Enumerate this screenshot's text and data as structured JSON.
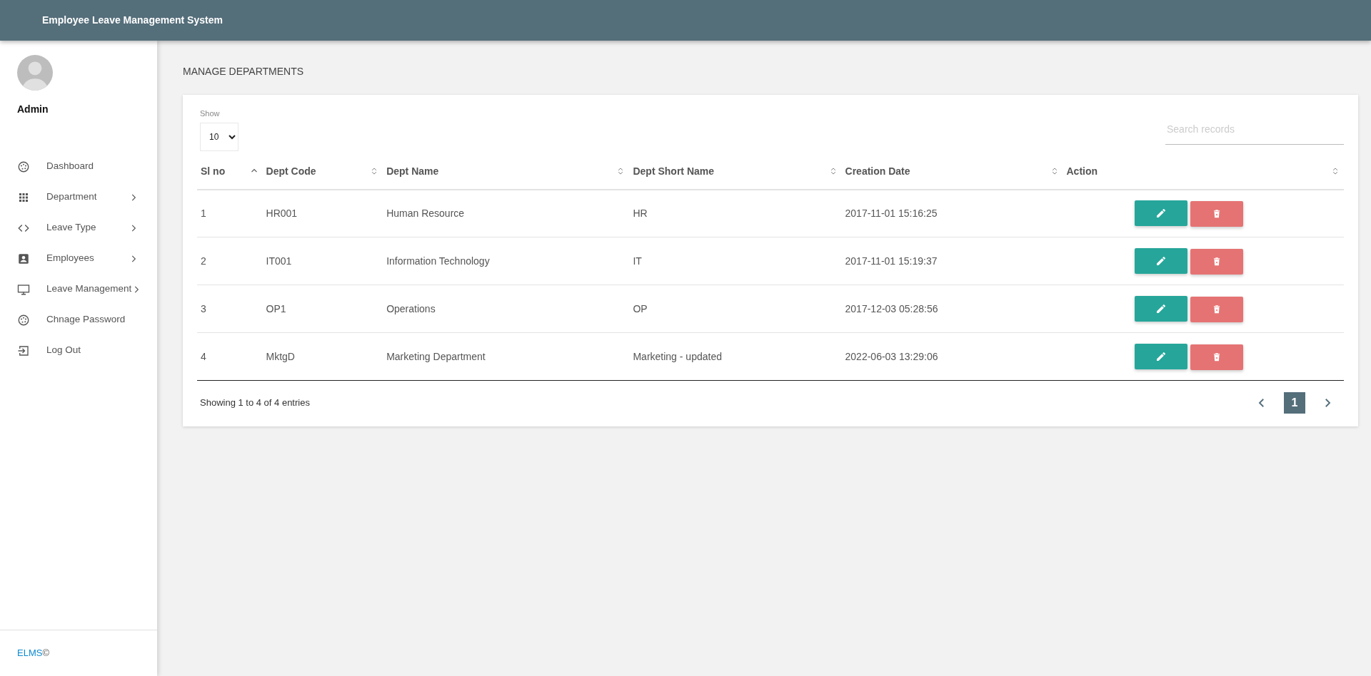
{
  "header": {
    "title": "Employee Leave Management System"
  },
  "sidebar": {
    "user": "Admin",
    "items": [
      {
        "label": "Dashboard",
        "kind": "palette",
        "submenu": false
      },
      {
        "label": "Department",
        "kind": "grid",
        "submenu": true
      },
      {
        "label": "Leave Type",
        "kind": "code",
        "submenu": true
      },
      {
        "label": "Employees",
        "kind": "contact",
        "submenu": true
      },
      {
        "label": "Leave Management",
        "kind": "monitor",
        "submenu": true
      },
      {
        "label": "Chnage Password",
        "kind": "palette",
        "submenu": false
      },
      {
        "label": "Log Out",
        "kind": "logout",
        "submenu": false
      }
    ],
    "footer": {
      "brand": "ELMS",
      "mark": "©"
    }
  },
  "page_title": "MANAGE DEPARTMENTS",
  "table_controls": {
    "show_label": "Show",
    "page_size": "10",
    "search": {
      "placeholder": "Search records"
    }
  },
  "table": {
    "columns": [
      {
        "label": "Sl no",
        "sorted": true
      },
      {
        "label": "Dept Code",
        "sorted": false
      },
      {
        "label": "Dept Name",
        "sorted": false
      },
      {
        "label": "Dept Short Name",
        "sorted": false
      },
      {
        "label": "Creation Date",
        "sorted": false
      },
      {
        "label": "Action",
        "sorted": false
      }
    ],
    "rows": [
      [
        "1",
        "HR001",
        "Human Resource",
        "HR",
        "2017-11-01 15:16:25"
      ],
      [
        "2",
        "IT001",
        "Information Technology",
        "IT",
        "2017-11-01 15:19:37"
      ],
      [
        "3",
        "OP1",
        "Operations",
        "OP",
        "2017-12-03 05:28:56"
      ],
      [
        "4",
        "MktgD",
        "Marketing Department",
        "Marketing - updated",
        "2022-06-03 13:29:06"
      ]
    ]
  },
  "info": "Showing 1 to 4 of 4 entries",
  "pagination": {
    "pages": [
      {
        "label": "1",
        "selected": true
      }
    ]
  }
}
